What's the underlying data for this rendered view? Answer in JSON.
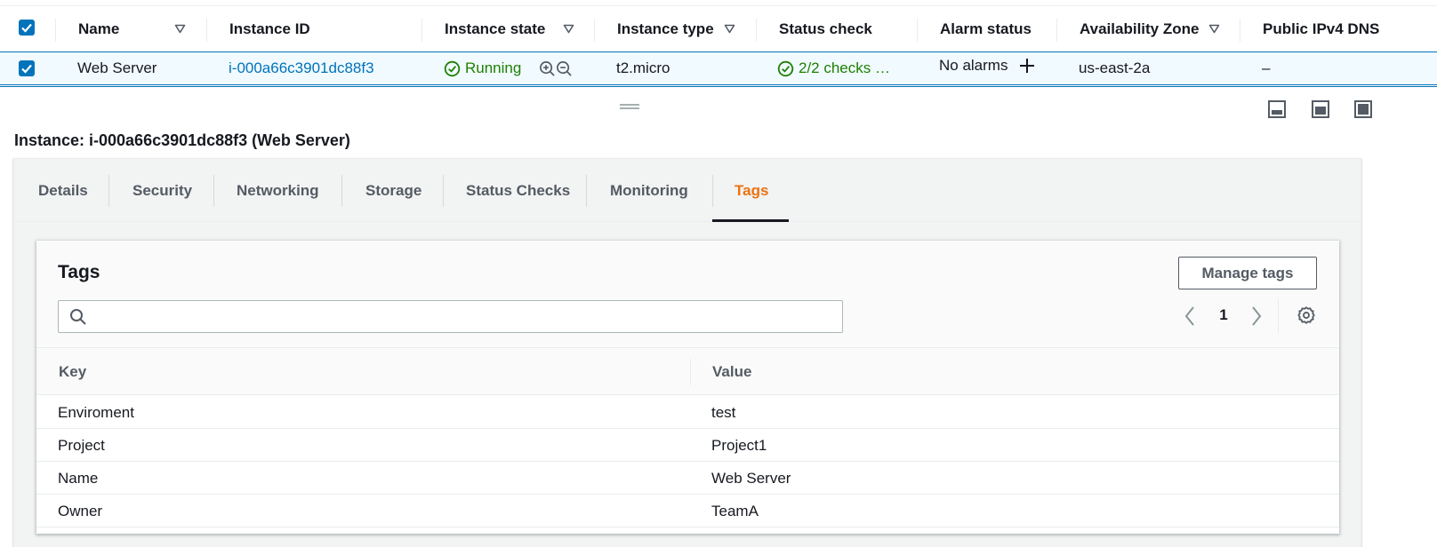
{
  "instances_table": {
    "columns": [
      {
        "label": "Name",
        "sortable": true
      },
      {
        "label": "Instance ID",
        "sortable": false
      },
      {
        "label": "Instance state",
        "sortable": true
      },
      {
        "label": "Instance type",
        "sortable": true
      },
      {
        "label": "Status check",
        "sortable": false
      },
      {
        "label": "Alarm status",
        "sortable": false
      },
      {
        "label": "Availability Zone",
        "sortable": true
      },
      {
        "label": "Public IPv4 DNS",
        "sortable": false
      }
    ],
    "row": {
      "selected": true,
      "name": "Web Server",
      "instance_id": "i-000a66c3901dc88f3",
      "state": "Running",
      "type": "t2.micro",
      "status_check": "2/2 checks …",
      "alarm_status": "No alarms",
      "availability_zone": "us-east-2a",
      "public_dns": "–"
    }
  },
  "detail": {
    "title": "Instance: i-000a66c3901dc88f3 (Web Server)",
    "tabs": [
      "Details",
      "Security",
      "Networking",
      "Storage",
      "Status Checks",
      "Monitoring",
      "Tags"
    ],
    "active_tab": "Tags"
  },
  "tags_card": {
    "title": "Tags",
    "manage_button": "Manage tags",
    "search": {
      "value": "",
      "placeholder": ""
    },
    "page": "1",
    "columns": [
      "Key",
      "Value"
    ],
    "rows": [
      {
        "key": "Enviroment",
        "value": "test"
      },
      {
        "key": "Project",
        "value": "Project1"
      },
      {
        "key": "Name",
        "value": "Web Server"
      },
      {
        "key": "Owner",
        "value": "TeamA"
      }
    ]
  },
  "colors": {
    "accent": "#0073bb",
    "active_tab": "#ec7211",
    "success": "#1d8102",
    "text": "#16191f",
    "muted": "#545b64"
  }
}
